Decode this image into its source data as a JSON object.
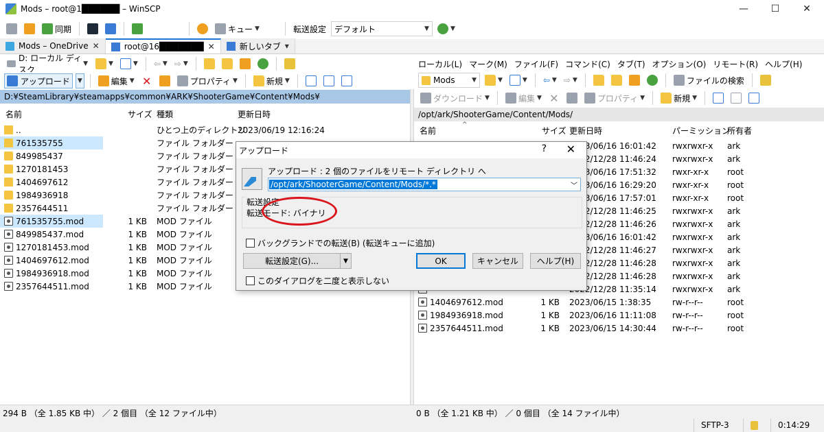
{
  "window": {
    "title": "Mods – root@1██████ – WinSCP",
    "controls": [
      "minimize-icon",
      "maximize-icon",
      "close-icon"
    ]
  },
  "toolbar": {
    "sync_label": "同期",
    "queue_label": "キュー",
    "transfer_settings_label": "転送設定",
    "transfer_preset": "デフォルト"
  },
  "tabs": [
    {
      "label": "Mods – OneDrive",
      "close": "✕"
    },
    {
      "label": "root@16███████",
      "close": "✕"
    },
    {
      "label": "新しいタブ",
      "close": "▾"
    }
  ],
  "left": {
    "drive": "D: ローカル ディスク",
    "upload_label": "アップロード",
    "edit_label": "編集",
    "properties_label": "プロパティ",
    "new_label": "新規",
    "path": "D:¥SteamLibrary¥steamapps¥common¥ARK¥ShooterGame¥Content¥Mods¥",
    "columns": {
      "name": "名前",
      "size": "サイズ",
      "type": "種類",
      "modified": "更新日時"
    },
    "rows": [
      {
        "name": "..",
        "size": "",
        "type": "ひとつ上のディレクトリ",
        "modified": "2023/06/19 12:16:24",
        "icon": "parent",
        "sel": false
      },
      {
        "name": "761535755",
        "size": "",
        "type": "ファイル フォルダー",
        "modified": "",
        "icon": "folder",
        "sel": true
      },
      {
        "name": "849985437",
        "size": "",
        "type": "ファイル フォルダー",
        "modified": "",
        "icon": "folder",
        "sel": false
      },
      {
        "name": "1270181453",
        "size": "",
        "type": "ファイル フォルダー",
        "modified": "",
        "icon": "folder",
        "sel": false
      },
      {
        "name": "1404697612",
        "size": "",
        "type": "ファイル フォルダー",
        "modified": "",
        "icon": "folder",
        "sel": false
      },
      {
        "name": "1984936918",
        "size": "",
        "type": "ファイル フォルダー",
        "modified": "",
        "icon": "folder",
        "sel": false
      },
      {
        "name": "2357644511",
        "size": "",
        "type": "ファイル フォルダー",
        "modified": "",
        "icon": "folder",
        "sel": false
      },
      {
        "name": "761535755.mod",
        "size": "1 KB",
        "type": "MOD ファイル",
        "modified": "",
        "icon": "mod",
        "sel": true
      },
      {
        "name": "849985437.mod",
        "size": "1 KB",
        "type": "MOD ファイル",
        "modified": "",
        "icon": "mod",
        "sel": false
      },
      {
        "name": "1270181453.mod",
        "size": "1 KB",
        "type": "MOD ファイル",
        "modified": "",
        "icon": "mod",
        "sel": false
      },
      {
        "name": "1404697612.mod",
        "size": "1 KB",
        "type": "MOD ファイル",
        "modified": "",
        "icon": "mod",
        "sel": false
      },
      {
        "name": "1984936918.mod",
        "size": "1 KB",
        "type": "MOD ファイル",
        "modified": "",
        "icon": "mod",
        "sel": false
      },
      {
        "name": "2357644511.mod",
        "size": "1 KB",
        "type": "MOD ファイル",
        "modified": "",
        "icon": "mod",
        "sel": false
      }
    ],
    "status": "294 B （全 1.85 KB 中） ／ 2 個目 （全 12 ファイル中）"
  },
  "right": {
    "menu": [
      "ローカル(L)",
      "マーク(M)",
      "ファイル(F)",
      "コマンド(C)",
      "タブ(T)",
      "オプション(O)",
      "リモート(R)",
      "ヘルプ(H)"
    ],
    "dir": "Mods",
    "find_label": "ファイルの検索",
    "download_label": "ダウンロード",
    "edit_label": "編集",
    "properties_label": "プロパティ",
    "new_label": "新規",
    "path": "/opt/ark/ShooterGame/Content/Mods/",
    "columns": {
      "name": "名前",
      "size": "サイズ",
      "modified": "更新日時",
      "perms": "パーミッション",
      "owner": "所有者"
    },
    "rows": [
      {
        "name": "",
        "size": "",
        "modified": "2023/06/16 16:01:42",
        "perms": "rwxrwxr-x",
        "owner": "ark",
        "icon": "folder"
      },
      {
        "name": "",
        "size": "",
        "modified": "2022/12/28 11:46:24",
        "perms": "rwxrwxr-x",
        "owner": "ark",
        "icon": "folder"
      },
      {
        "name": "",
        "size": "",
        "modified": "2023/06/16 17:51:32",
        "perms": "rwxr-xr-x",
        "owner": "root",
        "icon": "folder"
      },
      {
        "name": "",
        "size": "",
        "modified": "2023/06/16 16:29:20",
        "perms": "rwxr-xr-x",
        "owner": "root",
        "icon": "folder"
      },
      {
        "name": "",
        "size": "",
        "modified": "2023/06/16 17:57:01",
        "perms": "rwxr-xr-x",
        "owner": "root",
        "icon": "folder"
      },
      {
        "name": "",
        "size": "",
        "modified": "2022/12/28 11:46:25",
        "perms": "rwxrwxr-x",
        "owner": "ark",
        "icon": "folder"
      },
      {
        "name": "",
        "size": "",
        "modified": "2022/12/28 11:46:26",
        "perms": "rwxrwxr-x",
        "owner": "ark",
        "icon": "folder"
      },
      {
        "name": "",
        "size": "",
        "modified": "2023/06/16 16:01:42",
        "perms": "rwxrwxr-x",
        "owner": "ark",
        "icon": "folder"
      },
      {
        "name": "",
        "size": "",
        "modified": "2022/12/28 11:46:27",
        "perms": "rwxrwxr-x",
        "owner": "ark",
        "icon": "folder"
      },
      {
        "name": "",
        "size": "",
        "modified": "2022/12/28 11:46:28",
        "perms": "rwxrwxr-x",
        "owner": "ark",
        "icon": "folder"
      },
      {
        "name": "",
        "size": "",
        "modified": "2022/12/28 11:46:28",
        "perms": "rwxrwxr-x",
        "owner": "ark",
        "icon": "folder"
      },
      {
        "name": "",
        "size": "",
        "modified": "2022/12/28 11:35:14",
        "perms": "rwxrwxr-x",
        "owner": "ark",
        "icon": "mod"
      },
      {
        "name": "1404697612.mod",
        "size": "1 KB",
        "modified": "2023/06/15 1:38:35",
        "perms": "rw-r--r--",
        "owner": "root",
        "icon": "mod"
      },
      {
        "name": "1984936918.mod",
        "size": "1 KB",
        "modified": "2023/06/16 11:11:08",
        "perms": "rw-r--r--",
        "owner": "root",
        "icon": "mod"
      },
      {
        "name": "2357644511.mod",
        "size": "1 KB",
        "modified": "2023/06/15 14:30:44",
        "perms": "rw-r--r--",
        "owner": "root",
        "icon": "mod"
      }
    ],
    "status": "0 B （全 1.21 KB 中） ／ 0 個目 （全 14 ファイル中）",
    "protocol": "SFTP-3",
    "time": "0:14:29"
  },
  "dialog": {
    "title": "アップロード",
    "help": "?",
    "close": "✕",
    "prompt": "アップロード : 2 個のファイルをリモート ディレクトリ へ",
    "target": "/opt/ark/ShooterGame/Content/Mods/*.*",
    "group_label": "転送設定",
    "transfer_mode": "転送モード: バイナリ",
    "background_label": "バックグランドでの転送(B) (転送キューに追加)",
    "settings_button": "転送設定(G)...",
    "ok": "OK",
    "cancel": "キャンセル",
    "help_button": "ヘルプ(H)",
    "dont_show": "このダイアログを二度と表示しない"
  },
  "colors": {
    "accent": "#0078d7",
    "left_path_bg": "#a9c8e8",
    "highlight_ring": "#d9141b"
  }
}
